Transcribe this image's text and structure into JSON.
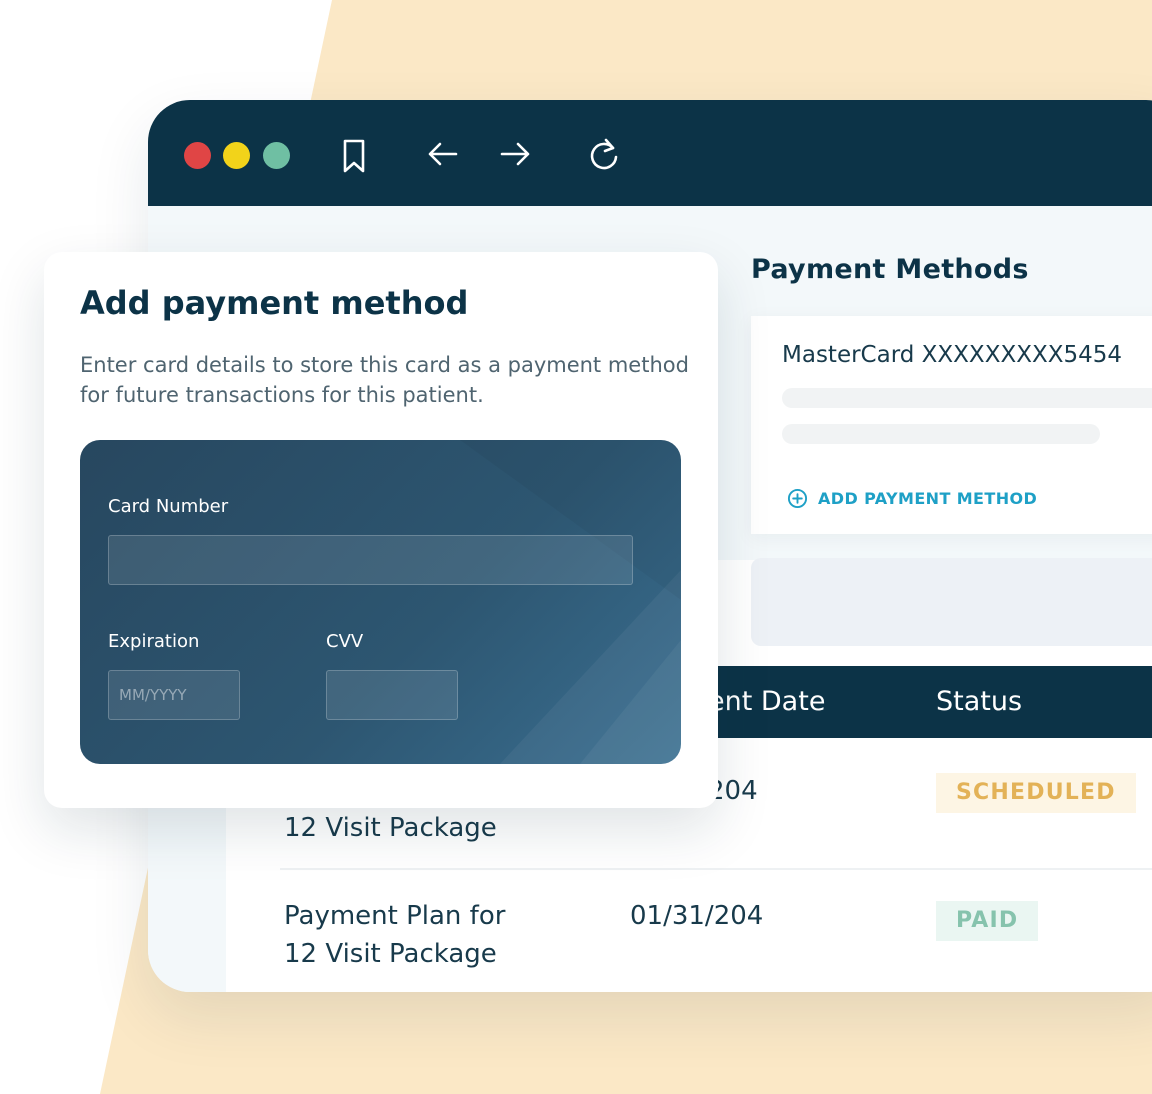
{
  "toolbar": {
    "window_controls": [
      "close-dot",
      "minimize-dot",
      "maximize-dot"
    ],
    "icons": [
      "bookmark-icon",
      "back-arrow-icon",
      "forward-arrow-icon",
      "reload-icon"
    ]
  },
  "modal": {
    "title": "Add payment method",
    "description": "Enter card details to store this card as a payment method for future transactions for this patient.",
    "card_number_label": "Card Number",
    "card_number_value": "",
    "expiration_label": "Expiration",
    "expiration_placeholder": "MM/YYYY",
    "cvv_label": "CVV",
    "cvv_value": ""
  },
  "payment_methods": {
    "title": "Payment Methods",
    "card_name": "MasterCard XXXXXXXXX5454",
    "add_label": "ADD PAYMENT METHOD",
    "add_icon": "plus-circle-icon"
  },
  "table": {
    "headers": {
      "date": "ent Date",
      "status": "Status"
    },
    "rows": [
      {
        "plan": "12 Visit Package",
        "date": "204",
        "status": "SCHEDULED"
      },
      {
        "plan": "Payment Plan for\n12 Visit Package",
        "date": "01/31/204",
        "status": "PAID"
      }
    ]
  },
  "colors": {
    "navy": "#0c3347",
    "accent_blue": "#1ea0c6",
    "dot_red": "#e04545",
    "dot_yellow": "#f2d31a",
    "dot_green": "#6fbfa3",
    "scheduled_text": "#e3b257",
    "scheduled_bg": "#fdf5e4",
    "paid_text": "#86c3ad",
    "paid_bg": "#eaf6f2",
    "background_shape": "#fbe8c6"
  }
}
